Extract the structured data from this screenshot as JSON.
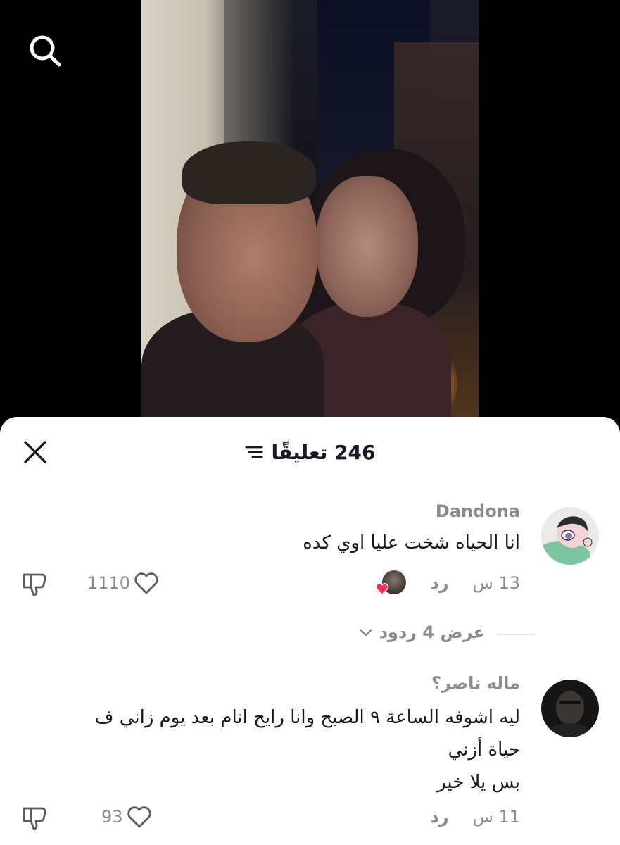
{
  "header": {
    "comment_count_label": "246 تعليقًا"
  },
  "icons": {
    "search": "search-icon",
    "close": "close-icon",
    "sort": "sort-filter-icon",
    "like": "heart-outline-icon",
    "dislike": "thumbs-down-icon",
    "chevron": "chevron-down-icon",
    "creator_like": "creator-liked-heart-icon"
  },
  "colors": {
    "text_primary": "#161823",
    "text_secondary": "#8a8b91",
    "creator_heart": "#fe2c55"
  },
  "comments": [
    {
      "username": "Dandona",
      "text": "انا الحياه شخت عليا اوي كده",
      "time": "13 س",
      "reply_label": "رد",
      "likes": "1110",
      "creator_liked": true,
      "view_replies_label": "عرض 4 ردود"
    },
    {
      "username": "ماله ناصر؟",
      "text_lines": [
        "ليه اشوفه الساعة ٩ الصبح وانا رايح انام بعد يوم زاني ف",
        "حياة أزني",
        "بس يلا خير"
      ],
      "time": "11 س",
      "reply_label": "رد",
      "likes": "93",
      "creator_liked": false
    }
  ]
}
